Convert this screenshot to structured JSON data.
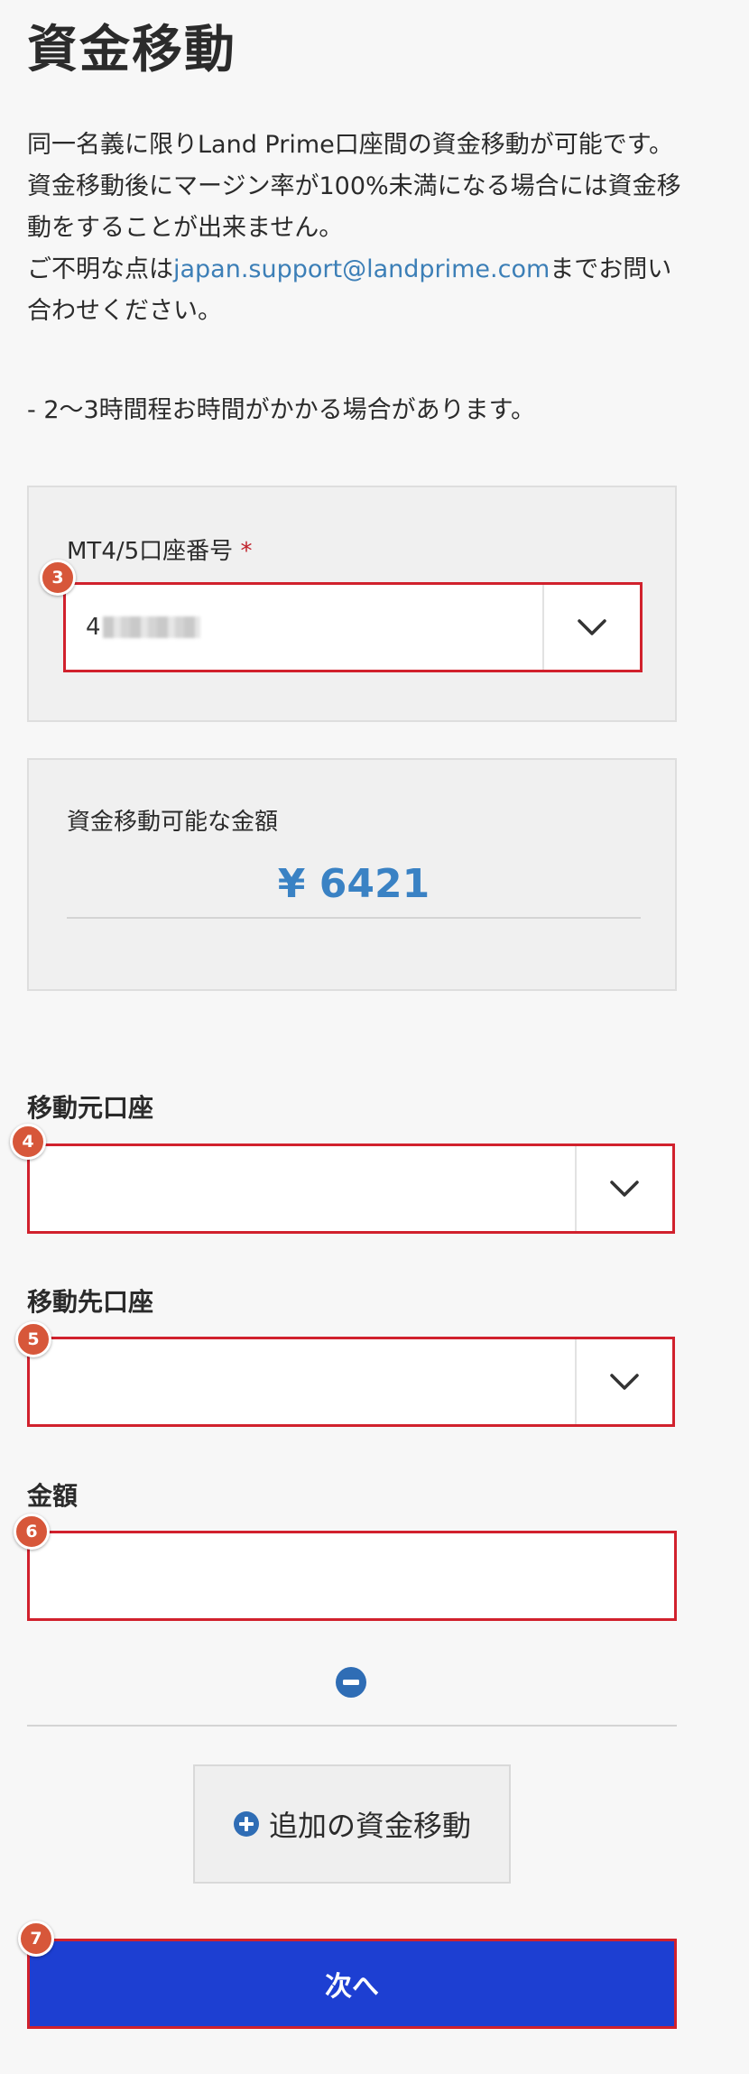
{
  "page": {
    "title": "資金移動"
  },
  "intro": {
    "line1": "同一名義に限りLand Prime口座間の資金移動が可能です。",
    "line2": "資金移動後にマージン率が100%未満になる場合には資金移動をすることが出来ません。",
    "line3_prefix": "ご不明な点は",
    "support_email": "japan.support@landprime.com",
    "line3_suffix": "までお問い合わせください。",
    "note": "- 2〜3時間程お時間がかかる場合があります。"
  },
  "account_panel": {
    "label": "MT4/5口座番号",
    "required_mark": "*",
    "selected_value_visible": "4",
    "badge": "3"
  },
  "available_panel": {
    "label": "資金移動可能な金額",
    "amount": "¥ 6421"
  },
  "from_account": {
    "label": "移動元口座",
    "value": "",
    "badge": "4"
  },
  "to_account": {
    "label": "移動先口座",
    "value": "",
    "badge": "5"
  },
  "amount_field": {
    "label": "金額",
    "value": "",
    "badge": "6"
  },
  "add_transfer": {
    "label": "追加の資金移動"
  },
  "next": {
    "label": "次へ",
    "badge": "7"
  },
  "icons": {
    "caret": "chevron-down-icon",
    "remove": "minus-circle-icon",
    "add": "plus-circle-icon"
  },
  "colors": {
    "highlight_border": "#d1212d",
    "badge": "#d7573a",
    "link": "#3c7fb7",
    "amount": "#3a82c4",
    "primary_button": "#1d3fd2",
    "icon_blue": "#2f6db5"
  }
}
